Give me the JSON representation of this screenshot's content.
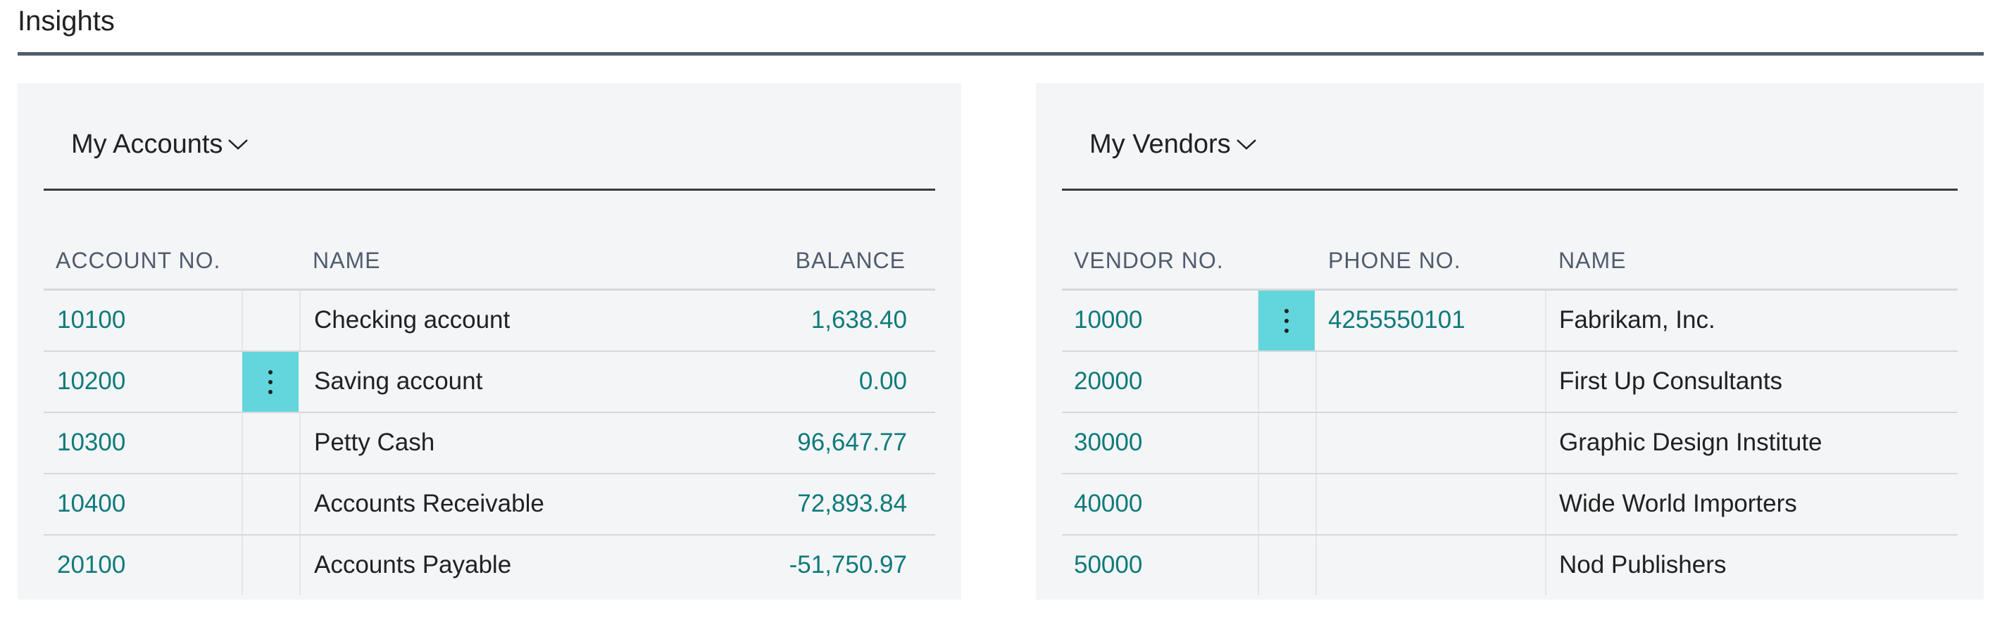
{
  "section": {
    "title": "Insights"
  },
  "accounts": {
    "title": "My Accounts",
    "columns": {
      "no": "ACCOUNT NO.",
      "name": "NAME",
      "balance": "BALANCE"
    },
    "rows": [
      {
        "no": "10100",
        "name": "Checking account",
        "balance": "1,638.40"
      },
      {
        "no": "10200",
        "name": "Saving account",
        "balance": "0.00"
      },
      {
        "no": "10300",
        "name": "Petty Cash",
        "balance": "96,647.77"
      },
      {
        "no": "10400",
        "name": "Accounts Receivable",
        "balance": "72,893.84"
      },
      {
        "no": "20100",
        "name": "Accounts Payable",
        "balance": "-51,750.97"
      }
    ]
  },
  "vendors": {
    "title": "My Vendors",
    "columns": {
      "no": "VENDOR NO.",
      "phone": "PHONE NO.",
      "name": "NAME"
    },
    "rows": [
      {
        "no": "10000",
        "phone": "4255550101",
        "name": "Fabrikam, Inc."
      },
      {
        "no": "20000",
        "phone": "",
        "name": "First Up Consultants"
      },
      {
        "no": "30000",
        "phone": "",
        "name": "Graphic Design Institute"
      },
      {
        "no": "40000",
        "phone": "",
        "name": "Wide World Importers"
      },
      {
        "no": "50000",
        "phone": "",
        "name": "Nod Publishers"
      }
    ]
  },
  "icons": {
    "title_chevron": "chevron-down-icon",
    "row_menu": "more-vertical-icon"
  },
  "colors": {
    "link": "#0f7a7a",
    "menu_highlight": "#62d6dc",
    "panel_bg": "#f4f5f7",
    "rule": "#505c6d"
  }
}
